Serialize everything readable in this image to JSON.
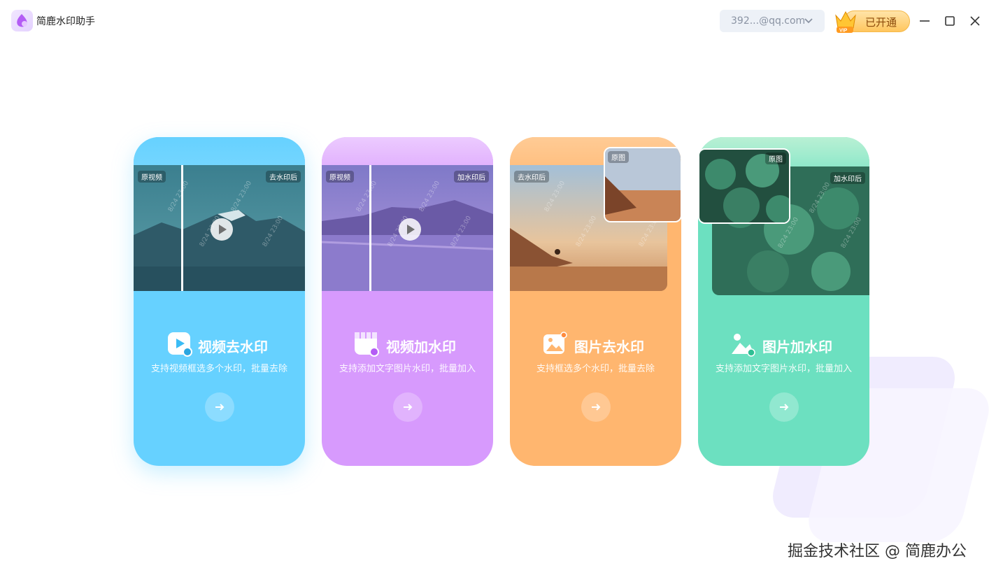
{
  "app": {
    "title": "简鹿水印助手"
  },
  "header": {
    "account_label": "392...@qq.com",
    "vip_label": "已开通",
    "vip_badge": "VIP"
  },
  "cards": [
    {
      "title": "视频去水印",
      "desc": "支持视频框选多个水印，批量去除",
      "tag_left": "原视频",
      "tag_right": "去水印后",
      "color": "#66d1ff"
    },
    {
      "title": "视频加水印",
      "desc": "支持添加文字图片水印，批量加入",
      "tag_left": "原视频",
      "tag_right": "加水印后",
      "color": "#d79afd"
    },
    {
      "title": "图片去水印",
      "desc": "支持框选多个水印，批量去除",
      "tag_left": "去水印后",
      "tag_right": "原图",
      "color": "#ffb66f"
    },
    {
      "title": "图片加水印",
      "desc": "支持添加文字图片水印，批量加入",
      "tag_left": "原图",
      "tag_right": "加水印后",
      "color": "#6ce0c0"
    }
  ],
  "watermark_text": "8/24 23:00",
  "footer": {
    "credit": "掘金技术社区 @ 简鹿办公"
  }
}
